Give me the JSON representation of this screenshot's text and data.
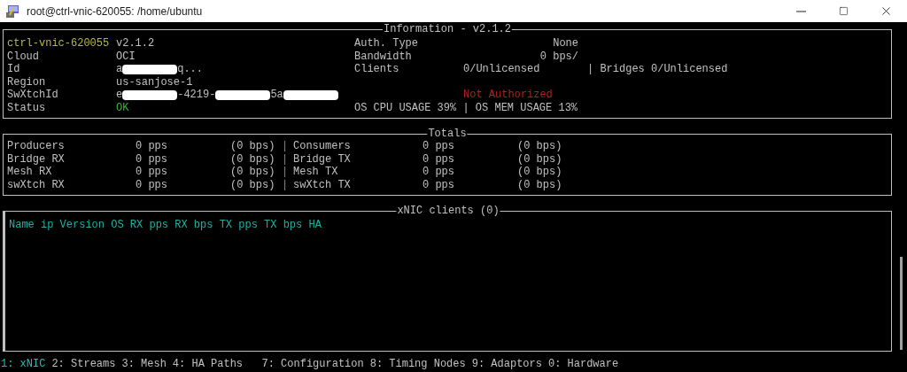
{
  "window": {
    "title": "root@ctrl-vnic-620055: /home/ubuntu"
  },
  "information": {
    "title": "Information - v2.1.2",
    "left_rows": [
      {
        "kind": "host",
        "label": "ctrl-vnic-620055",
        "segments": [
          {
            "kind": "text",
            "text": "v2.1.2"
          }
        ]
      },
      {
        "kind": "plain",
        "label": "Cloud",
        "segments": [
          {
            "kind": "text",
            "text": "OCI"
          }
        ]
      },
      {
        "kind": "plain",
        "label": "Id",
        "segments": [
          {
            "kind": "text",
            "text": "a"
          },
          {
            "kind": "redacted"
          },
          {
            "kind": "text",
            "text": "q..."
          }
        ]
      },
      {
        "kind": "plain",
        "label": "Region",
        "segments": [
          {
            "kind": "text",
            "text": "us-sanjose-1"
          }
        ]
      },
      {
        "kind": "plain",
        "label": "SwXtchId",
        "segments": [
          {
            "kind": "text",
            "text": "e"
          },
          {
            "kind": "redacted"
          },
          {
            "kind": "text",
            "text": "-4219-"
          },
          {
            "kind": "redacted"
          },
          {
            "kind": "text",
            "text": "5a"
          },
          {
            "kind": "redacted"
          }
        ]
      },
      {
        "kind": "ok",
        "label": "Status",
        "segments": [
          {
            "kind": "text",
            "text": "OK"
          }
        ]
      }
    ],
    "right_rows": [
      {
        "kind": "pair",
        "label": "Auth. Type",
        "value": "None"
      },
      {
        "kind": "pair",
        "label": "Bandwidth",
        "value": "0 bps/"
      },
      {
        "kind": "clients",
        "label": "Clients",
        "value": "0/Unlicensed",
        "extra": "| Bridges 0/Unlicensed"
      },
      {
        "kind": "blank"
      },
      {
        "kind": "alert",
        "value": "Not Authorized"
      },
      {
        "kind": "text",
        "label": "OS CPU USAGE 39% | OS MEM USAGE 13%"
      }
    ]
  },
  "totals": {
    "title": "Totals",
    "rows": [
      {
        "label": "Producers",
        "pps": "0 pps",
        "bps": "(0 bps)",
        "sep": "|",
        "label2": "Consumers",
        "pps2": "0 pps",
        "bps2": "(0 bps)"
      },
      {
        "label": "Bridge RX",
        "pps": "0 pps",
        "bps": "(0 bps)",
        "sep": "|",
        "label2": "Bridge TX",
        "pps2": "0 pps",
        "bps2": "(0 bps)"
      },
      {
        "label": "Mesh RX",
        "pps": "0 pps",
        "bps": "(0 bps)",
        "sep": "|",
        "label2": "Mesh TX",
        "pps2": "0 pps",
        "bps2": "(0 bps)"
      },
      {
        "label": "swXtch RX",
        "pps": "0 pps",
        "bps": "(0 bps)",
        "sep": "|",
        "label2": "swXtch TX",
        "pps2": "0 pps",
        "bps2": "(0 bps)"
      }
    ]
  },
  "xnic_clients": {
    "title": "xNIC clients (0)",
    "header": "Name ip Version OS RX pps RX bps TX pps TX bps HA"
  },
  "menu_bar": [
    {
      "label": "1: xNIC",
      "selected": true
    },
    {
      "label": "2: Streams",
      "selected": false
    },
    {
      "label": "3: Mesh",
      "selected": false
    },
    {
      "label": "4: HA Paths",
      "selected": false
    },
    {
      "label": "  7: Configuration",
      "selected": false
    },
    {
      "label": "8: Timing Nodes",
      "selected": false
    },
    {
      "label": "9: Adaptors",
      "selected": false
    },
    {
      "label": "0: Hardware",
      "selected": false
    }
  ]
}
